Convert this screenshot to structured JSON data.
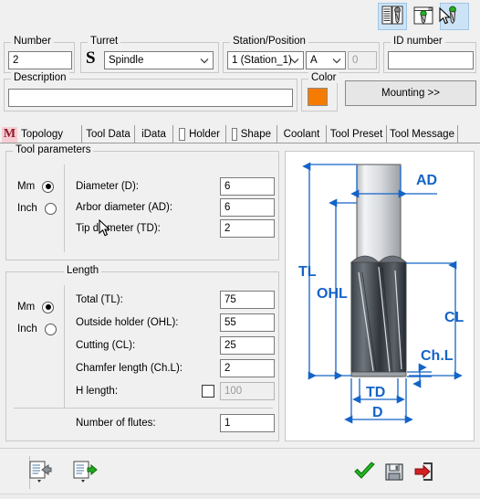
{
  "toolbar": {
    "buttons": [
      {
        "name": "tool-list-view-button",
        "icon": "list-drill-icon",
        "active": true,
        "title": "Tool list"
      },
      {
        "name": "tool-window-view-button",
        "icon": "window-drill-icon",
        "active": false,
        "title": "Tool window"
      },
      {
        "name": "tool-detail-view-button",
        "icon": "drill-icon",
        "active": true,
        "title": "Tool detail"
      }
    ]
  },
  "header": {
    "number": {
      "label": "Number",
      "value": "2"
    },
    "turret": {
      "label": "Turret",
      "icon": "spindle-s-icon",
      "value": "Spindle"
    },
    "station": {
      "label": "Station/Position",
      "station_value": "1 (Station_1)",
      "position_value": "A",
      "offset_value": "0"
    },
    "id_number": {
      "label": "ID number",
      "value": ""
    },
    "description": {
      "label": "Description",
      "value": "",
      "placeholder": ""
    },
    "color": {
      "label": "Color",
      "value": "#F57C00"
    },
    "mounting_button": "Mounting >>"
  },
  "tabs": [
    {
      "label": "Topology",
      "icon": "m-icon",
      "active": true
    },
    {
      "label": "Tool Data",
      "icon": "",
      "active": false
    },
    {
      "label": "iData",
      "icon": "",
      "active": false
    },
    {
      "label": "Holder",
      "icon": "box-icon",
      "active": false
    },
    {
      "label": "Shape",
      "icon": "box-icon",
      "active": false
    },
    {
      "label": "Coolant",
      "icon": "",
      "active": false
    },
    {
      "label": "Tool Preset",
      "icon": "",
      "active": false
    },
    {
      "label": "Tool Message",
      "icon": "",
      "active": false
    }
  ],
  "tool_parameters": {
    "legend": "Tool parameters",
    "units": {
      "mm_label": "Mm",
      "inch_label": "Inch",
      "selected": "Mm"
    },
    "fields": [
      {
        "label": "Diameter (D):",
        "value": "6"
      },
      {
        "label": "Arbor diameter (AD):",
        "value": "6"
      },
      {
        "label": "Tip diameter (TD):",
        "value": "2"
      }
    ]
  },
  "length": {
    "legend": "Length",
    "units": {
      "mm_label": "Mm",
      "inch_label": "Inch",
      "selected": "Mm"
    },
    "fields": [
      {
        "label": "Total (TL):",
        "value": "75",
        "disabled": false,
        "checkbox": false
      },
      {
        "label": "Outside holder (OHL):",
        "value": "55",
        "disabled": false,
        "checkbox": false
      },
      {
        "label": "Cutting (CL):",
        "value": "25",
        "disabled": false,
        "checkbox": false
      },
      {
        "label": "Chamfer length (Ch.L):",
        "value": "2",
        "disabled": false,
        "checkbox": false
      },
      {
        "label": "H length:",
        "value": "100",
        "disabled": true,
        "checkbox": true,
        "checked": false
      }
    ],
    "flutes": {
      "label": "Number of flutes:",
      "value": "1"
    }
  },
  "diagram": {
    "name": "end-mill-dimension-diagram",
    "dimension_labels": {
      "ad": "AD",
      "tl": "TL",
      "ohl": "OHL",
      "cl": "CL",
      "chl": "Ch.L",
      "td": "TD",
      "d": "D"
    },
    "accent_color": "#1464C8"
  },
  "bottom_bar": {
    "left_buttons": [
      {
        "name": "import-tool-button",
        "icon": "list-left-arrow-icon"
      },
      {
        "name": "export-tool-button",
        "icon": "list-right-arrow-icon"
      }
    ],
    "right_buttons": [
      {
        "name": "apply-button",
        "icon": "green-check-icon"
      },
      {
        "name": "save-button",
        "icon": "floppy-disk-icon"
      },
      {
        "name": "exit-button",
        "icon": "red-exit-arrow-icon"
      }
    ]
  }
}
